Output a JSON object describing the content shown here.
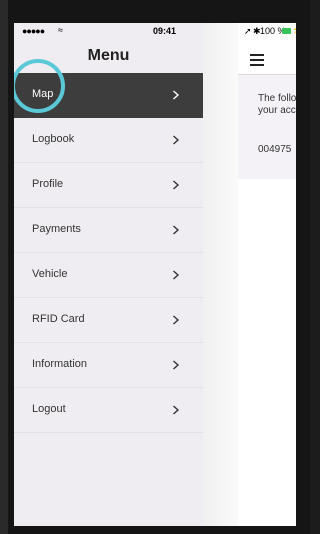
{
  "status": {
    "time": "09:41",
    "signal": "●●●●●",
    "wifi": "≈",
    "battery_text": "100 %",
    "bluetooth": "✱",
    "location_arrow": "➚"
  },
  "menu": {
    "title": "Menu",
    "items": [
      {
        "label": "Map",
        "active": true
      },
      {
        "label": "Logbook",
        "active": false
      },
      {
        "label": "Profile",
        "active": false
      },
      {
        "label": "Payments",
        "active": false
      },
      {
        "label": "Vehicle",
        "active": false
      },
      {
        "label": "RFID Card",
        "active": false
      },
      {
        "label": "Information",
        "active": false
      },
      {
        "label": "Logout",
        "active": false
      }
    ]
  },
  "behind": {
    "text_line1": "The follo",
    "text_line2": "your acc",
    "number": "004975"
  },
  "colors": {
    "active_bg": "#3d3d3d",
    "menu_bg": "#efedf1",
    "highlight_ring": "#5bc8d8",
    "battery": "#38c45a"
  },
  "icons": {
    "menu_chevron": "chevron-right-icon",
    "hamburger": "hamburger-menu-icon"
  }
}
